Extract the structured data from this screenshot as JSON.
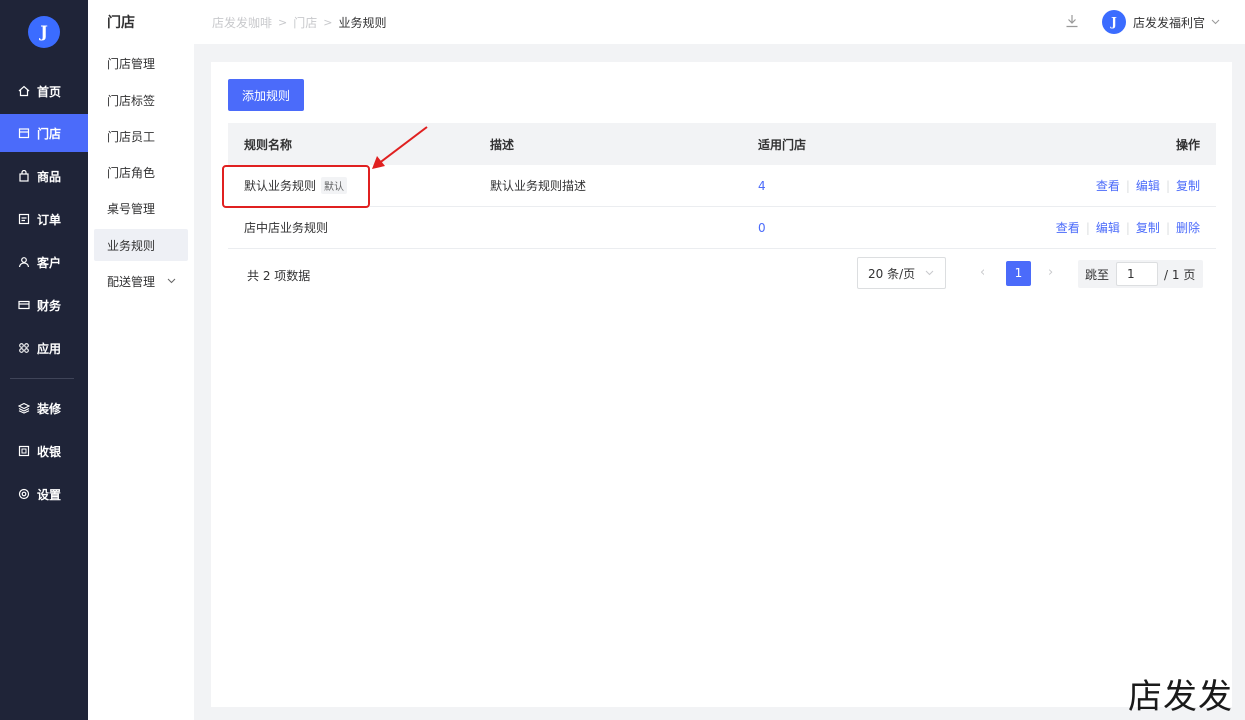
{
  "brand": {
    "logo_glyph": "J",
    "accent": "#4b6bfa",
    "nav_bg": "#1f2438"
  },
  "nav": {
    "items": [
      {
        "label": "首页",
        "icon": "home-icon"
      },
      {
        "label": "门店",
        "icon": "store-icon",
        "active": true
      },
      {
        "label": "商品",
        "icon": "bag-icon"
      },
      {
        "label": "订单",
        "icon": "order-icon"
      },
      {
        "label": "客户",
        "icon": "user-icon"
      },
      {
        "label": "财务",
        "icon": "wallet-icon"
      },
      {
        "label": "应用",
        "icon": "apps-icon"
      },
      {
        "label": "装修",
        "icon": "layers-icon"
      },
      {
        "label": "收银",
        "icon": "cashier-icon"
      },
      {
        "label": "设置",
        "icon": "gear-icon"
      }
    ]
  },
  "subnav": {
    "title": "门店",
    "items": [
      {
        "label": "门店管理"
      },
      {
        "label": "门店标签"
      },
      {
        "label": "门店员工"
      },
      {
        "label": "门店角色"
      },
      {
        "label": "桌号管理"
      },
      {
        "label": "业务规则",
        "active": true
      },
      {
        "label": "配送管理",
        "expandable": true
      }
    ]
  },
  "header": {
    "breadcrumb": [
      "店发发咖啡",
      "门店",
      "业务规则"
    ],
    "download_icon": "download-icon",
    "user_name": "店发发福利官",
    "avatar_glyph": "J"
  },
  "main": {
    "add_button": "添加规则",
    "columns": [
      "规则名称",
      "描述",
      "适用门店",
      "操作"
    ],
    "rows": [
      {
        "name": "默认业务规则",
        "tag": "默认",
        "description": "默认业务规则描述",
        "stores": "4",
        "actions": [
          "查看",
          "编辑",
          "复制"
        ]
      },
      {
        "name": "店中店业务规则",
        "tag": "",
        "description": "",
        "stores": "0",
        "actions": [
          "查看",
          "编辑",
          "复制",
          "删除"
        ]
      }
    ],
    "pagination": {
      "total": "共 2 项数据",
      "page_size": "20 条/页",
      "current_page": "1",
      "jump_label": "跳至",
      "jump_value": "1",
      "of_pages": "/ 1 页"
    }
  },
  "watermark": "店发发"
}
